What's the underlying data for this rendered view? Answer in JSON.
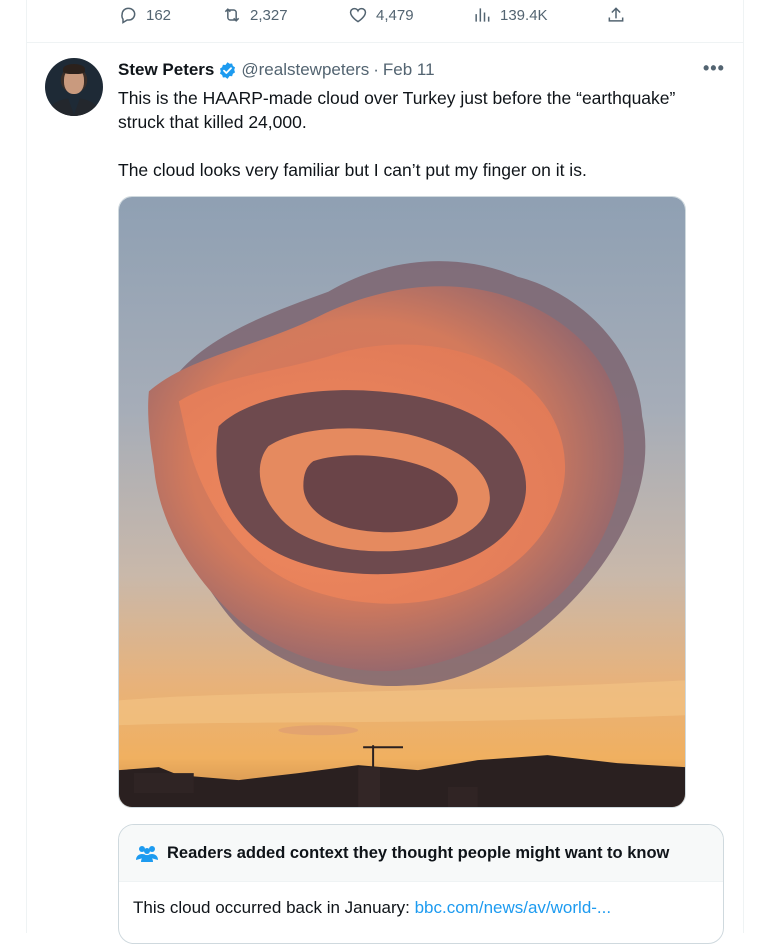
{
  "actions": {
    "replies": "162",
    "retweets": "2,327",
    "likes": "4,479",
    "views": "139.4K"
  },
  "tweet": {
    "author_name": "Stew Peters",
    "handle": "@realstewpeters",
    "separator": "·",
    "date": "Feb 11",
    "more": "•••",
    "text_paragraph_1": "This is the HAARP-made cloud over Turkey just before the “earthquake” struck that killed 24,000.",
    "text_paragraph_2": "The cloud looks very familiar but I can’t put my finger on it is."
  },
  "community_note": {
    "title": "Readers added context they thought people might want to know",
    "body": "This cloud occurred back in January: ",
    "link": "bbc.com/news/av/world-..."
  },
  "colors": {
    "accent": "#1d9bf0",
    "secondary_text": "#536471"
  },
  "icons": [
    "reply-icon",
    "retweet-icon",
    "like-icon",
    "views-icon",
    "share-icon",
    "verified-badge-icon",
    "more-icon",
    "people-icon"
  ]
}
